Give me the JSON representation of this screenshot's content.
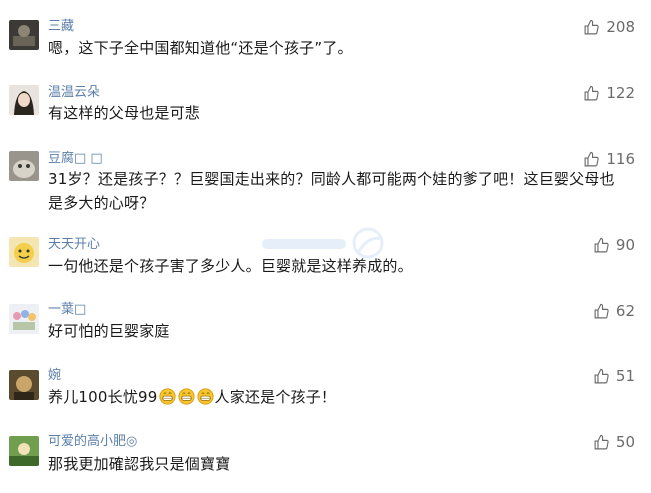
{
  "comments": [
    {
      "username": "三藏",
      "text": "嗯，这下子全中国都知道他“还是个孩子”了。",
      "likes": "208"
    },
    {
      "username": "温温云朵",
      "text": "有这样的父母也是可悲",
      "likes": "122"
    },
    {
      "username": "豆腐□ □",
      "text": "31岁？还是孩子？？巨婴国走出来的？同龄人都可能两个娃的爹了吧！这巨婴父母也是多大的心呀？",
      "likes": "116"
    },
    {
      "username": "天天开心",
      "text": "一句他还是个孩子害了多少人。巨婴就是这样养成的。",
      "likes": "90"
    },
    {
      "username": "一葉□",
      "text": "好可怕的巨婴家庭",
      "likes": "62"
    },
    {
      "username": "婉",
      "text_before": "养儿100长忧99",
      "text_after": "人家还是个孩子！",
      "likes": "51"
    },
    {
      "username": "可爱的高小肥◎",
      "text": "那我更加確認我只是個寶寶",
      "likes": "50"
    }
  ],
  "icons": {
    "like": "thumbs-up-icon",
    "emoji": "grinning-face-icon"
  },
  "colors": {
    "username": "#5b7fa8",
    "text": "#1a1a1a",
    "likes": "#6b6b6b"
  }
}
